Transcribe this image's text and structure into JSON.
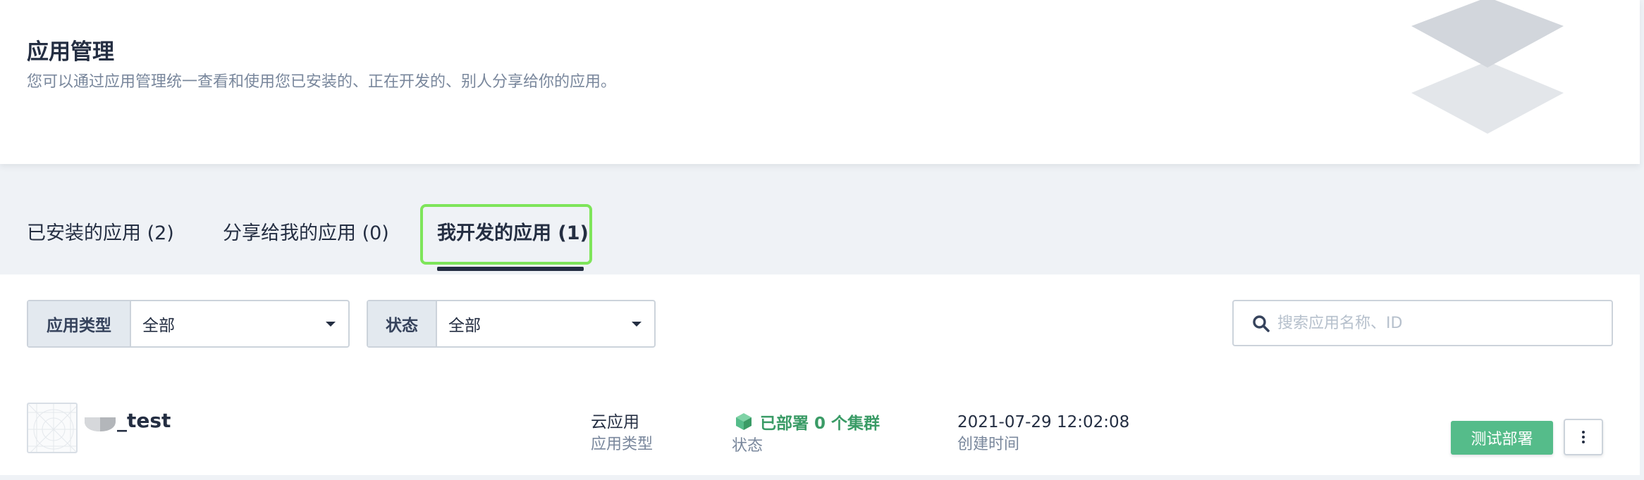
{
  "header": {
    "title": "应用管理",
    "description": "您可以通过应用管理统一查看和使用您已安装的、正在开发的、别人分享给你的应用。",
    "icon": "layers-icon"
  },
  "tabs": [
    {
      "label": "已安装的应用 (2)",
      "active": false
    },
    {
      "label": "分享给我的应用 (0)",
      "active": false
    },
    {
      "label": "我开发的应用 (1)",
      "active": true
    }
  ],
  "filters": {
    "app_type": {
      "label": "应用类型",
      "value": "全部"
    },
    "status": {
      "label": "状态",
      "value": "全部"
    }
  },
  "search": {
    "placeholder": "搜索应用名称、ID",
    "icon": "search-icon"
  },
  "apps": [
    {
      "name": "_test",
      "app_type_value": "云应用",
      "app_type_label": "应用类型",
      "status_value": "已部署 0 个集群",
      "status_label": "状态",
      "created_value": "2021-07-29 12:02:08",
      "created_label": "创建时间",
      "action_label": "测试部署"
    }
  ],
  "colors": {
    "accent_green": "#55bc8a",
    "status_green": "#3a9b66",
    "highlight_box": "#7ee55a",
    "text_primary": "#242e42",
    "text_secondary": "#79879c"
  }
}
